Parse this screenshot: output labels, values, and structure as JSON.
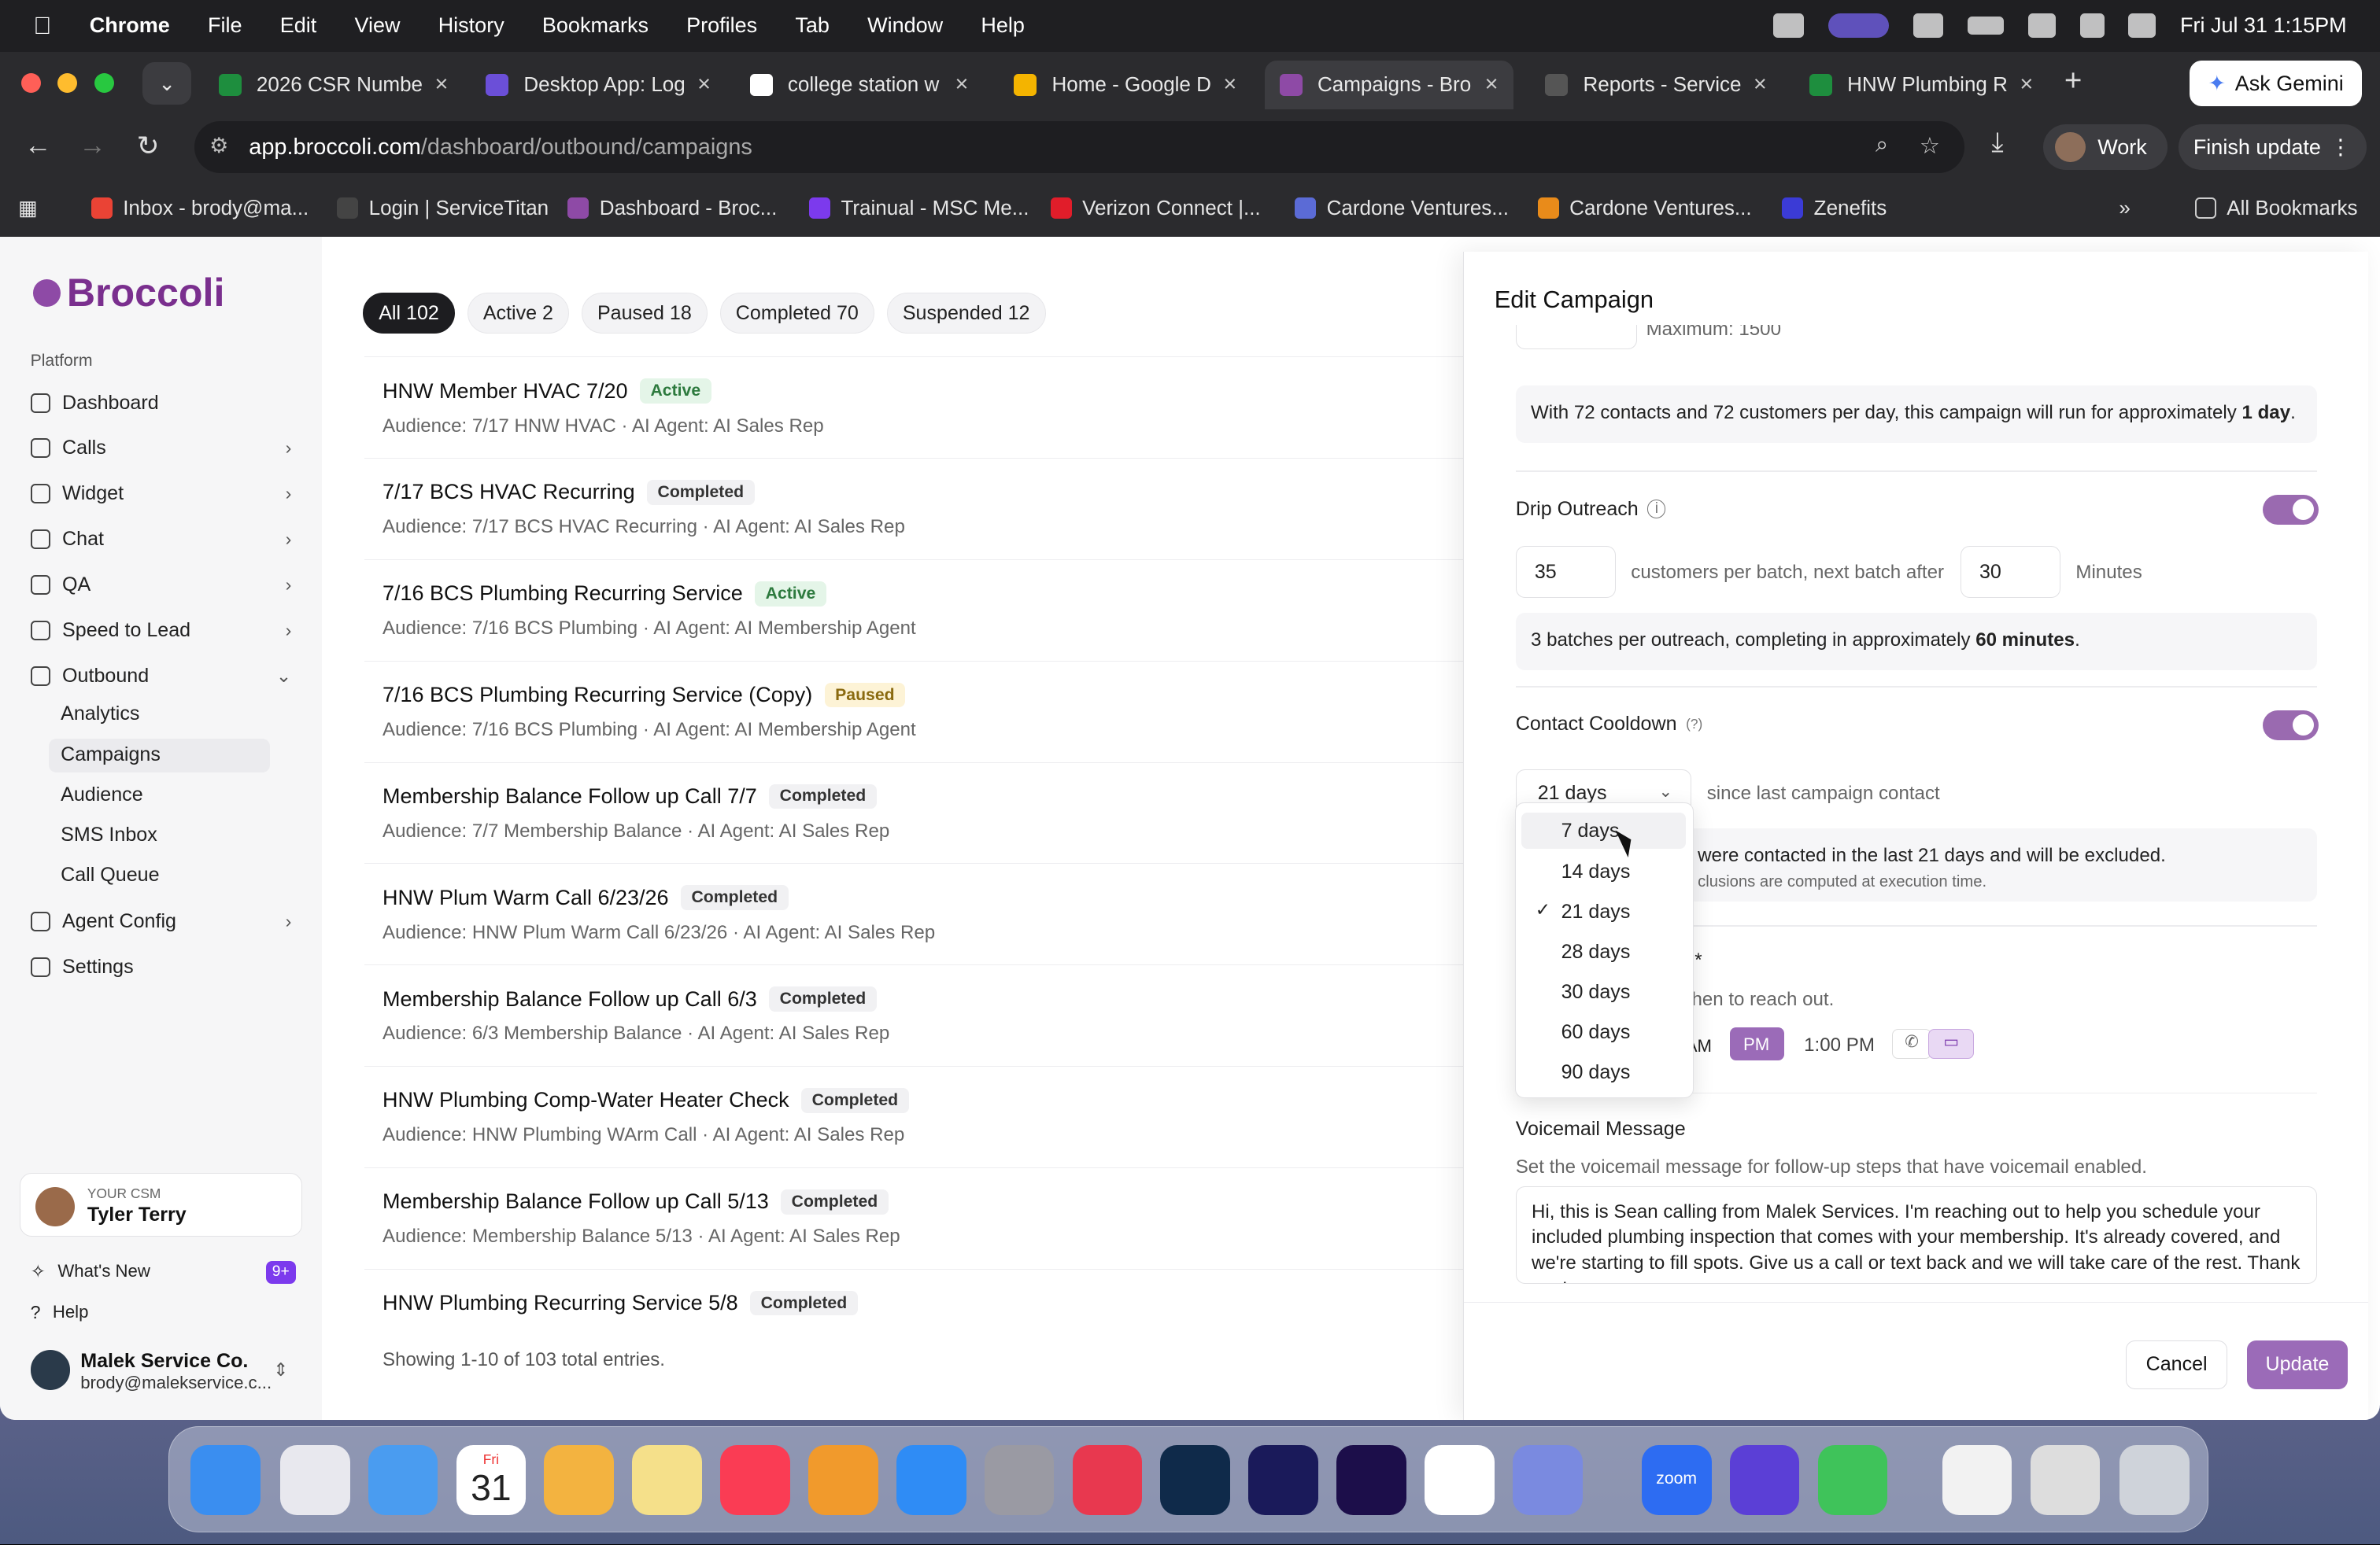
{
  "menubar": {
    "app": "Chrome",
    "items": [
      "File",
      "Edit",
      "View",
      "History",
      "Bookmarks",
      "Profiles",
      "Tab",
      "Window",
      "Help"
    ],
    "datetime": "Fri Jul 31  1:15PM"
  },
  "browser": {
    "tabs": [
      {
        "label": "2026 CSR Numbe",
        "color": "#1e8e3e"
      },
      {
        "label": "Desktop App: Log",
        "color": "#6b4fd8"
      },
      {
        "label": "college station w",
        "color": "#ffffff"
      },
      {
        "label": "Home - Google D",
        "color": "#f4b400"
      },
      {
        "label": "Campaigns - Bro",
        "color": "#8e4aa6"
      },
      {
        "label": "Reports - Service",
        "color": "#555555"
      },
      {
        "label": "HNW Plumbing R",
        "color": "#1e8e3e"
      }
    ],
    "gemini": "Ask Gemini",
    "url_host": "app.broccoli.com",
    "url_path": "/dashboard/outbound/campaigns",
    "profile": "Work",
    "finish_update": "Finish update",
    "bookmarks": [
      {
        "label": "Inbox - brody@ma...",
        "color": "#ea4335"
      },
      {
        "label": "Login | ServiceTitan",
        "color": "#444444"
      },
      {
        "label": "Dashboard - Broc...",
        "color": "#8e4aa6"
      },
      {
        "label": "Trainual - MSC Me...",
        "color": "#7c3aed"
      },
      {
        "label": "Verizon Connect |...",
        "color": "#e11d2a"
      },
      {
        "label": "Cardone Ventures...",
        "color": "#5b6bd6"
      },
      {
        "label": "Cardone Ventures...",
        "color": "#e98b1a"
      },
      {
        "label": "Zenefits",
        "color": "#3b3bd6"
      }
    ],
    "all_bookmarks": "All Bookmarks"
  },
  "sidebar": {
    "logo": "Broccoli",
    "section": "Platform",
    "items": [
      {
        "label": "Dashboard",
        "chev": ""
      },
      {
        "label": "Calls",
        "chev": "›"
      },
      {
        "label": "Widget",
        "chev": "›"
      },
      {
        "label": "Chat",
        "chev": "›"
      },
      {
        "label": "QA",
        "chev": "›"
      },
      {
        "label": "Speed to Lead",
        "chev": "›"
      },
      {
        "label": "Outbound",
        "chev": "⌄"
      }
    ],
    "sub_items": [
      "Analytics",
      "Campaigns",
      "Audience",
      "SMS Inbox",
      "Call Queue"
    ],
    "items2": [
      {
        "label": "Agent Config",
        "chev": "›"
      },
      {
        "label": "Settings",
        "chev": ""
      }
    ],
    "csm_caption": "YOUR CSM",
    "csm_name": "Tyler Terry",
    "whats_new": "What's New",
    "whats_new_badge": "9+",
    "help": "Help",
    "account_name": "Malek Service Co.",
    "account_email": "brody@malekservice.c..."
  },
  "filters": [
    "All 102",
    "Active 2",
    "Paused 18",
    "Completed 70",
    "Suspended 12"
  ],
  "campaigns": [
    {
      "name": "HNW Member HVAC 7/20",
      "status": "Active",
      "audience": "Audience: 7/17 HNW HVAC",
      "agent": "AI Agent: AI Sales Rep"
    },
    {
      "name": "7/17 BCS HVAC Recurring",
      "status": "Completed",
      "audience": "Audience: 7/17 BCS HVAC Recurring",
      "agent": "AI Agent: AI Sales Rep"
    },
    {
      "name": "7/16 BCS Plumbing Recurring Service",
      "status": "Active",
      "audience": "Audience: 7/16 BCS Plumbing",
      "agent": "AI Agent: AI Membership Agent"
    },
    {
      "name": "7/16 BCS Plumbing Recurring Service (Copy)",
      "status": "Paused",
      "audience": "Audience: 7/16 BCS Plumbing",
      "agent": "AI Agent: AI Membership Agent"
    },
    {
      "name": "Membership Balance Follow up Call 7/7",
      "status": "Completed",
      "audience": "Audience: 7/7 Membership Balance",
      "agent": "AI Agent: AI Sales Rep"
    },
    {
      "name": "HNW Plum Warm Call 6/23/26",
      "status": "Completed",
      "audience": "Audience: HNW Plum Warm Call 6/23/26",
      "agent": "AI Agent: AI Sales Rep"
    },
    {
      "name": "Membership Balance Follow up Call 6/3",
      "status": "Completed",
      "audience": "Audience: 6/3 Membership Balance",
      "agent": "AI Agent: AI Sales Rep"
    },
    {
      "name": "HNW Plumbing Comp-Water Heater Check",
      "status": "Completed",
      "audience": "Audience: HNW Plumbing WArm Call",
      "agent": "AI Agent: AI Sales Rep"
    },
    {
      "name": "Membership Balance Follow up Call 5/13",
      "status": "Completed",
      "audience": "Audience: Membership Balance 5/13",
      "agent": "AI Agent: AI Sales Rep"
    },
    {
      "name": "HNW Plumbing Recurring Service 5/8",
      "status": "Completed",
      "audience": "",
      "agent": ""
    }
  ],
  "showing": "Showing 1-10 of 103 total entries.",
  "edit": {
    "title": "Edit Campaign",
    "per_day_value": "72",
    "max_text": "Maximum: 1500",
    "run_note_pre": "With 72 contacts and 72 customers per day, this campaign will run for approximately ",
    "run_note_bold": "1 day",
    "run_note_post": ".",
    "drip_label": "Drip Outreach",
    "batch_size": "35",
    "batch_text": "customers per batch, next batch after",
    "batch_interval": "30",
    "minutes": "Minutes",
    "batch_note_pre": "3 batches per outreach, completing in approximately ",
    "batch_note_bold": "60 minutes",
    "batch_note_post": ".",
    "cooldown_label": "Contact Cooldown",
    "cooldown_hint": "(?)",
    "cooldown_value": "21 days",
    "since_text": "since last campaign contact",
    "excluded_text": "were contacted in the last 21 days and will be excluded.",
    "exclusions_text": "clusions are computed at execution time.",
    "asterisk": "*",
    "reach_text": "hen to reach out.",
    "am": "AM",
    "pm": "PM",
    "time": "1:00 PM",
    "voicemail_label": "Voicemail Message",
    "voicemail_sub": "Set the voicemail message for follow-up steps that have voicemail enabled.",
    "voicemail_text": "Hi, this is Sean calling from Malek Services. I'm reaching out to help you schedule your included plumbing inspection that comes with your membership. It's already covered, and we're starting to fill spots. Give us a call or text back and we will take care of the rest. Thank you!",
    "cancel": "Cancel",
    "update": "Update",
    "options": [
      "7 days",
      "14 days",
      "21 days",
      "28 days",
      "30 days",
      "60 days",
      "90 days"
    ],
    "selected_option": "21 days"
  },
  "dock": {
    "calendar_month": "Fri",
    "calendar_day": "31",
    "zoom": "zoom"
  },
  "colors": {
    "brand": "#8e4aa6",
    "accent": "#9b6bb8",
    "active_green": "#2d7a3e",
    "paused_amber": "#8a6a10"
  }
}
